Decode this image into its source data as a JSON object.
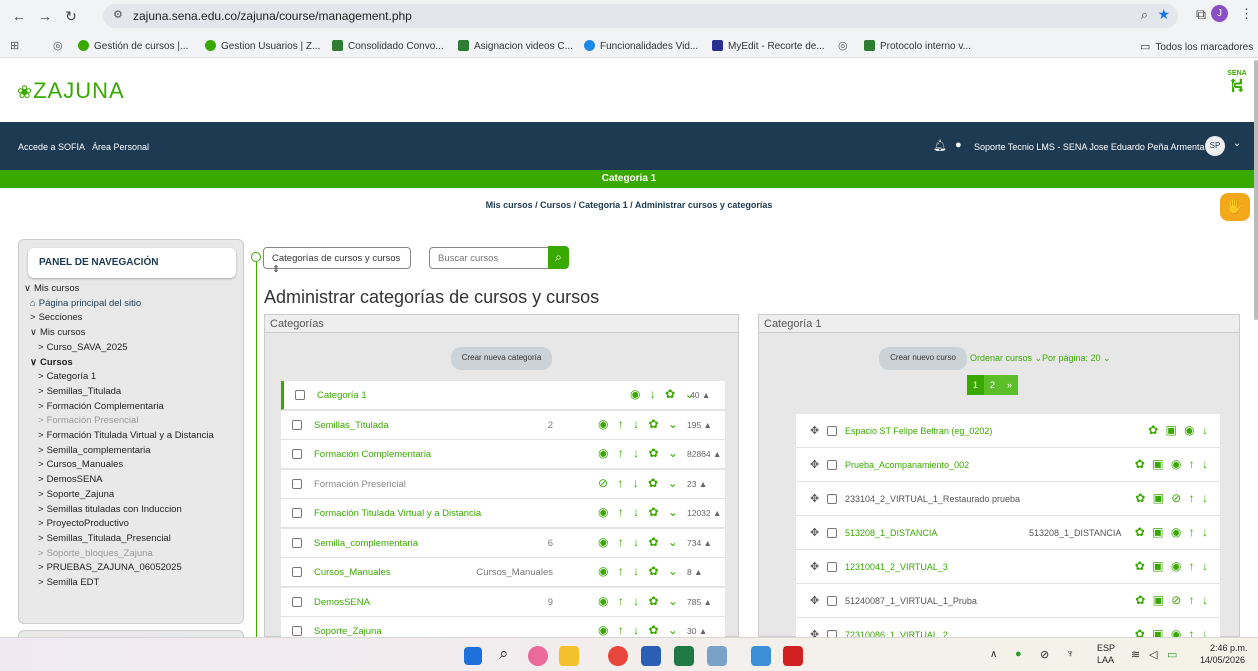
{
  "browser": {
    "url": "zajuna.sena.edu.co/zajuna/course/management.php",
    "bookmarks": [
      "Gestión de cursos |...",
      "Gestion Usuarios | Z...",
      "Consolidado Convo...",
      "Asignacion videos C...",
      "Funcionalidades Vid...",
      "MyEdit - Recorte de...",
      "Protocolo interno v..."
    ],
    "all_bookmarks": "Todos los marcadores",
    "profile_initial": "J"
  },
  "site": {
    "logo": "ZAJUNA",
    "sena_logo": "SENA",
    "nav_links": [
      "Accede a SOFIA",
      "Área Personal"
    ],
    "user_name": "Soporte Tecnio LMS - SENA Jose Eduardo Peña Armenta",
    "user_initials": "SP",
    "category_bar": "Categoria 1",
    "breadcrumb": "Mis cursos / Cursos / Categoría 1 / Administrar cursos y categorías"
  },
  "sidebar": {
    "title": "PANEL DE NAVEGACIÓN",
    "items": [
      {
        "label": "Mis cursos",
        "prefix": "∨"
      },
      {
        "label": "Página principal del sitio",
        "prefix": "⌂"
      },
      {
        "label": "Secciones",
        "prefix": ">"
      },
      {
        "label": "Mis cursos",
        "prefix": "∨"
      },
      {
        "label": "Curso_SAVA_2025",
        "prefix": ">"
      },
      {
        "label": "Cursos",
        "prefix": "∨"
      },
      {
        "label": "Categoría 1",
        "prefix": ">"
      },
      {
        "label": "Semillas_Titulada",
        "prefix": ">"
      },
      {
        "label": "Formación Complementaria",
        "prefix": ">"
      },
      {
        "label": "Formación Presencial",
        "prefix": ">"
      },
      {
        "label": "Formación Titulada Virtual y a Distancia",
        "prefix": ">"
      },
      {
        "label": "Semilla_complementaria",
        "prefix": ">"
      },
      {
        "label": "Cursos_Manuales",
        "prefix": ">"
      },
      {
        "label": "DemosSENA",
        "prefix": ">"
      },
      {
        "label": "Soporte_Zajuna",
        "prefix": ">"
      },
      {
        "label": "Semillas tituladas con Induccion",
        "prefix": ">"
      },
      {
        "label": "ProyectoProductivo",
        "prefix": ">"
      },
      {
        "label": "Semillas_Titulada_Presencial",
        "prefix": ">"
      },
      {
        "label": "Soporte_bloques_Zajuna",
        "prefix": ">"
      },
      {
        "label": "PRUEBAS_ZAJUNA_06052025",
        "prefix": ">"
      },
      {
        "label": "Semilla EDT",
        "prefix": ">"
      }
    ]
  },
  "main": {
    "view_select": "Categorías de cursos y cursos ⇕",
    "search_placeholder": "Buscar cursos",
    "page_title": "Administrar categorías de cursos y cursos",
    "categories_heading": "Categorías",
    "new_category_button": "Crear nueva categoría",
    "categories": [
      {
        "name": "Categoría 1",
        "extra": "",
        "actions": "◉ ↓ ✿ ⌄",
        "count": "40"
      },
      {
        "name": "Semillas_Titulada",
        "extra": "2",
        "actions": "◉ ↑ ↓ ✿ ⌄",
        "count": "195"
      },
      {
        "name": "Formación Complementaria",
        "extra": "",
        "actions": "◉ ↑ ↓ ✿ ⌄",
        "count": "82864"
      },
      {
        "name": "Formación Presencial",
        "extra": "",
        "actions": "⊘ ↑ ↓ ✿ ⌄",
        "count": "23"
      },
      {
        "name": "Formación Titulada Virtual y a Distancia",
        "extra": "",
        "actions": "◉ ↑ ↓ ✿ ⌄",
        "count": "12032"
      },
      {
        "name": "Semilla_complementaria",
        "extra": "6",
        "actions": "◉ ↑ ↓ ✿ ⌄",
        "count": "734"
      },
      {
        "name": "Cursos_Manuales",
        "extra": "Cursos_Manuales",
        "actions": "◉ ↑ ↓ ✿ ⌄",
        "count": "8"
      },
      {
        "name": "DemosSENA",
        "extra": "9",
        "actions": "◉ ↑ ↓ ✿ ⌄",
        "count": "785"
      },
      {
        "name": "Soporte_Zajuna",
        "extra": "",
        "actions": "◉ ↑ ↓ ✿ ⌄",
        "count": "30"
      }
    ],
    "course_panel_heading": "Categoría 1",
    "new_course_button": "Crear nuevo curso",
    "sort_label": "Ordenar cursos ⌄",
    "per_page_label": "Por página: 20 ⌄",
    "pagination": [
      "1",
      "2",
      "»"
    ],
    "courses": [
      {
        "name": "Espacio ST Felipe Beltran (eg_0202)",
        "extra": "",
        "actions": "✿ ▣ ◉ ↓",
        "hidden": false
      },
      {
        "name": "Prueba_Acompanamiento_002",
        "extra": "",
        "actions": "✿ ▣ ◉ ↑ ↓",
        "hidden": false
      },
      {
        "name": "233104_2_VIRTUAL_1_Restaurado prueba",
        "extra": "",
        "actions": "✿ ▣ ⊘ ↑ ↓",
        "hidden": true
      },
      {
        "name": "513208_1_DISTANCIA",
        "extra": "513208_1_DISTANCIA",
        "actions": "✿ ▣ ◉ ↑ ↓",
        "hidden": false
      },
      {
        "name": "12310041_2_VIRTUAL_3",
        "extra": "",
        "actions": "✿ ▣ ◉ ↑ ↓",
        "hidden": false
      },
      {
        "name": "51240087_1_VIRTUAL_1_Pruba",
        "extra": "",
        "actions": "✿ ▣ ⊘ ↑ ↓",
        "hidden": true
      },
      {
        "name": "72310086_1_VIRTUAL_2",
        "extra": "",
        "actions": "✿ ▣ ◉ ↑ ↓",
        "hidden": false
      }
    ]
  },
  "taskbar": {
    "lang": "ESP",
    "lang_sub": "LAA",
    "time": "2:46 p.m.",
    "date": "14/05/2026"
  },
  "colors": {
    "accent": "#39a900",
    "navy": "#1d3a52"
  }
}
